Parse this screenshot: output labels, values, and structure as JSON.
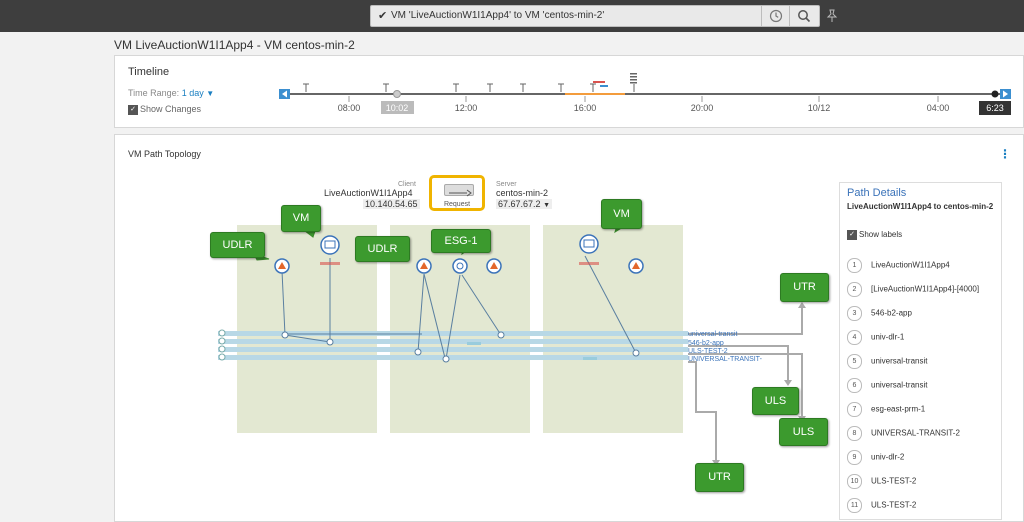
{
  "search": {
    "query": "VM 'LiveAuctionW1I1App4' to VM 'centos-min-2'"
  },
  "page_title": "VM LiveAuctionW1I1App4 - VM centos-min-2",
  "timeline": {
    "title": "Timeline",
    "time_range_label": "Time Range:",
    "time_range_value": "1 day",
    "show_changes": "Show Changes",
    "ticks": [
      "08:00",
      "10:02",
      "12:00",
      "16:00",
      "20:00",
      "10/12",
      "04:00",
      "6:23"
    ]
  },
  "topology": {
    "title": "VM Path Topology",
    "client_label": "Client",
    "client_name": "LiveAuctionW1I1App4",
    "client_ip": "10.140.54.65",
    "server_label": "Server",
    "server_name": "centos-min-2",
    "server_ip": "67.67.67.2",
    "request_label": "Request",
    "segments": [
      "universal-transit",
      "546-b2-app",
      "ULS-TEST-2",
      "UNIVERSAL-TRANSIT-"
    ],
    "callouts": {
      "vm1": "VM",
      "udlr1": "UDLR",
      "udlr2": "UDLR",
      "esg1": "ESG-1",
      "vm2": "VM",
      "utr1": "UTR",
      "uls1": "ULS",
      "uls2": "ULS",
      "utr2": "UTR"
    }
  },
  "path_details": {
    "title": "Path Details",
    "subtitle": "LiveAuctionW1I1App4 to centos-min-2",
    "show_labels": "Show labels",
    "items": [
      {
        "num": "1",
        "label": "LiveAuctionW1I1App4"
      },
      {
        "num": "2",
        "label": "[LiveAuctionW1I1App4]-[4000]"
      },
      {
        "num": "3",
        "label": "546-b2-app"
      },
      {
        "num": "4",
        "label": "univ-dlr-1"
      },
      {
        "num": "5",
        "label": "universal-transit"
      },
      {
        "num": "6",
        "label": "universal-transit"
      },
      {
        "num": "7",
        "label": "esg-east-prm-1"
      },
      {
        "num": "8",
        "label": "UNIVERSAL-TRANSIT-2"
      },
      {
        "num": "9",
        "label": "univ-dlr-2"
      },
      {
        "num": "10",
        "label": "ULS-TEST-2"
      },
      {
        "num": "11",
        "label": "ULS-TEST-2"
      }
    ]
  },
  "colors": {
    "accent": "#1a7fc1",
    "callout": "#3c9a2e",
    "highlight": "#f0b400",
    "zone": "#e3e8d2"
  }
}
